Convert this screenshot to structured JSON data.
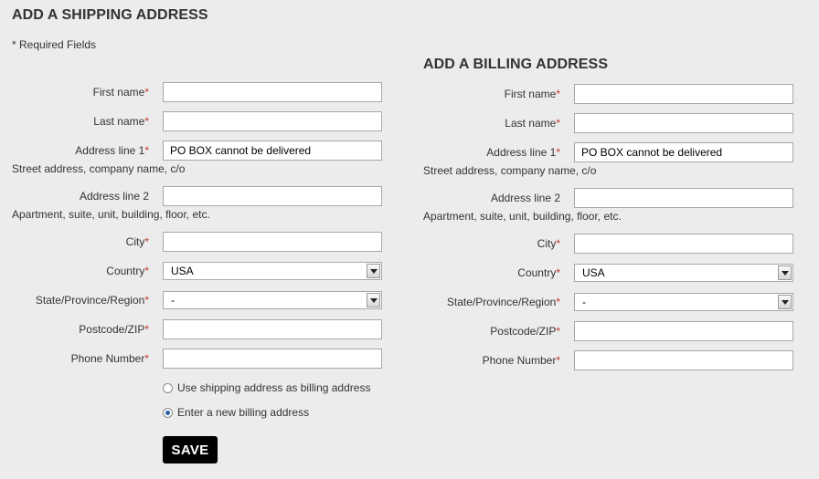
{
  "shipping": {
    "title": "ADD A SHIPPING ADDRESS",
    "required_note": "* Required Fields",
    "first_name_label": "First name",
    "last_name_label": "Last name",
    "address1_label": "Address line 1",
    "address1_value": "PO BOX cannot be delivered",
    "address1_hint": "Street address, company name, c/o",
    "address2_label": "Address line 2",
    "address2_hint": "Apartment, suite, unit, building, floor, etc.",
    "city_label": "City",
    "country_label": "Country",
    "country_value": "USA",
    "state_label": "State/Province/Region",
    "state_value": "-",
    "postcode_label": "Postcode/ZIP",
    "phone_label": "Phone Number",
    "radio_use_shipping": "Use shipping address as billing address",
    "radio_new_billing": "Enter a new billing address",
    "save_label": "SAVE"
  },
  "billing": {
    "title": "ADD A BILLING ADDRESS",
    "first_name_label": "First name",
    "last_name_label": "Last name",
    "address1_label": "Address line 1",
    "address1_value": "PO BOX cannot be delivered",
    "address1_hint": "Street address, company name, c/o",
    "address2_label": "Address line 2",
    "address2_hint": "Apartment, suite, unit, building, floor, etc.",
    "city_label": "City",
    "country_label": "Country",
    "country_value": "USA",
    "state_label": "State/Province/Region",
    "state_value": "-",
    "postcode_label": "Postcode/ZIP",
    "phone_label": "Phone Number"
  },
  "required_marker": "*",
  "colors": {
    "background": "#ececec",
    "required": "#c0392b",
    "button": "#000000"
  }
}
